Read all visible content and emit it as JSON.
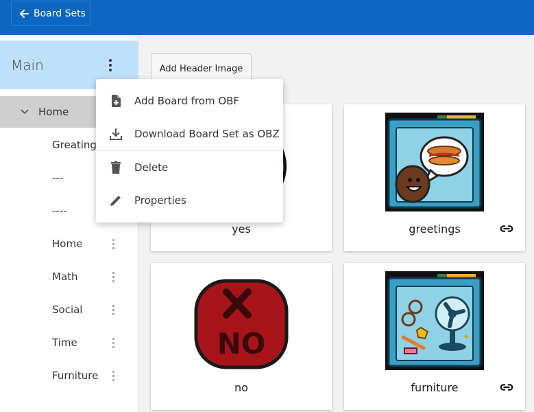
{
  "topbar": {
    "back_label": "Board Sets"
  },
  "sidebar": {
    "title": "Main",
    "home_label": "Home",
    "items": [
      {
        "label": "Greatings"
      },
      {
        "label": "---"
      },
      {
        "label": "----"
      },
      {
        "label": "Home"
      },
      {
        "label": "Math"
      },
      {
        "label": "Social"
      },
      {
        "label": "Time"
      },
      {
        "label": "Furniture"
      }
    ]
  },
  "content": {
    "add_header_label": "Add Header Image",
    "cards": [
      {
        "label": "yes",
        "icon": "yes-symbol",
        "linked": false
      },
      {
        "label": "greetings",
        "icon": "greetings-folder",
        "linked": true
      },
      {
        "label": "no",
        "icon": "no-symbol",
        "linked": false
      },
      {
        "label": "furniture",
        "icon": "furniture-folder",
        "linked": true
      }
    ]
  },
  "menu": {
    "items": [
      {
        "label": "Add Board from OBF",
        "icon": "add-file-icon"
      },
      {
        "label": "Download Board Set as OBZ",
        "icon": "download-icon"
      },
      {
        "label": "Delete",
        "icon": "trash-icon"
      },
      {
        "label": "Properties",
        "icon": "pencil-icon"
      }
    ]
  },
  "colors": {
    "topbar": "#0b67c2",
    "sidebar_selected": "#bfe0fb",
    "home_row": "#cfcfcf",
    "folder_blue": "#3a9fc4",
    "no_red": "#a8141a"
  }
}
